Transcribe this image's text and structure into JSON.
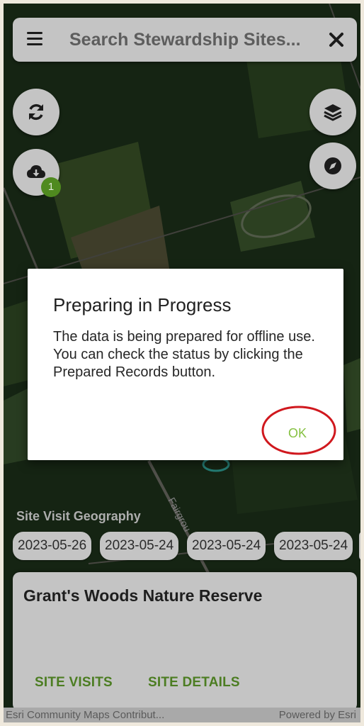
{
  "search": {
    "placeholder": "Search Stewardship Sites..."
  },
  "map_controls": {
    "refresh": "refresh-icon",
    "download": "cloud-download-icon",
    "download_badge": "1",
    "layers": "layers-icon",
    "compass": "compass-icon"
  },
  "map_labels": {
    "road": "Fairgrou"
  },
  "dialog": {
    "title": "Preparing in Progress",
    "message": "The data is being prepared for offline use. You can check the status by clicking the Prepared Records button.",
    "ok_label": "OK",
    "highlight_color": "#d0181e"
  },
  "geography": {
    "label": "Site Visit Geography",
    "chips": [
      "2023-05-26",
      "2023-05-24",
      "2023-05-24",
      "2023-05-24"
    ]
  },
  "card": {
    "title": "Grant's Woods Nature Reserve",
    "site_visits_label": "SITE VISITS",
    "site_details_label": "SITE DETAILS"
  },
  "attribution": {
    "left": "Esri Community Maps Contribut...",
    "right": "Powered by Esri"
  },
  "colors": {
    "accent_green": "#86c142",
    "button_green": "#4c7d22",
    "badge_green": "#4f8a1f"
  }
}
